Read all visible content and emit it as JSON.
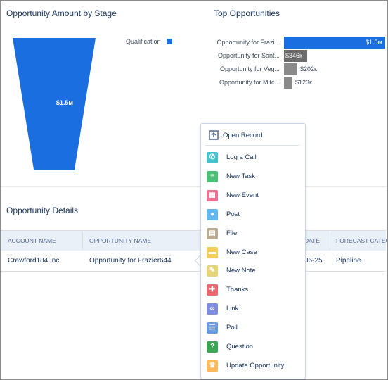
{
  "funnel_card": {
    "title": "Opportunity Amount by Stage",
    "legend": [
      {
        "label": "Qualification",
        "color": "#1b6ee0"
      }
    ],
    "stages": [
      {
        "stage": "Qualification",
        "value_label": "$1.5м"
      }
    ]
  },
  "top_card": {
    "title": "Top Opportunities",
    "bars": [
      {
        "label": "Opportunity for Frazi...",
        "value": 1.5,
        "value_label": "$1.5м",
        "color": "#1b6ee0"
      },
      {
        "label": "Opportunity for Sant...",
        "value": 0.346,
        "value_label": "$346к",
        "color": "#6b6b6b"
      },
      {
        "label": "Opportunity for Veg...",
        "value": 0.202,
        "value_label": "$202к",
        "color": "#8a8a8a"
      },
      {
        "label": "Opportunity for Mitc...",
        "value": 0.123,
        "value_label": "$123к",
        "color": "#8a8a8a"
      }
    ]
  },
  "details": {
    "title": "Opportunity Details",
    "columns": [
      "ACCOUNT NAME",
      "OPPORTUNITY NAME",
      "",
      "DATE",
      "FORECAST CATEGO"
    ],
    "rows": [
      [
        "Crawford184 Inc",
        "Opportunity for Frazier644",
        "",
        "06-25",
        "Pipeline"
      ]
    ]
  },
  "menu": {
    "header": {
      "label": "Open Record",
      "icon": "open-record-icon"
    },
    "items": [
      {
        "label": "Log a Call",
        "icon": "phone-icon",
        "color": "#48c3cc",
        "glyph": "✆"
      },
      {
        "label": "New Task",
        "icon": "task-icon",
        "color": "#4bc076",
        "glyph": "≡"
      },
      {
        "label": "New Event",
        "icon": "calendar-icon",
        "color": "#eb7092",
        "glyph": "▦"
      },
      {
        "label": "Post",
        "icon": "chat-icon",
        "color": "#62b7ed",
        "glyph": "●"
      },
      {
        "label": "File",
        "icon": "file-icon",
        "color": "#baac93",
        "glyph": "▤"
      },
      {
        "label": "New Case",
        "icon": "case-icon",
        "color": "#f2cf5b",
        "glyph": "▬"
      },
      {
        "label": "New Note",
        "icon": "note-icon",
        "color": "#e6d478",
        "glyph": "✎"
      },
      {
        "label": "Thanks",
        "icon": "gift-icon",
        "color": "#e9696e",
        "glyph": "✚"
      },
      {
        "label": "Link",
        "icon": "link-icon",
        "color": "#7f8de1",
        "glyph": "∞"
      },
      {
        "label": "Poll",
        "icon": "poll-icon",
        "color": "#699be1",
        "glyph": "☰"
      },
      {
        "label": "Question",
        "icon": "question-icon",
        "color": "#3ba755",
        "glyph": "?"
      },
      {
        "label": "Update Opportunity",
        "icon": "crown-icon",
        "color": "#fcb95b",
        "glyph": "♛"
      }
    ]
  }
}
